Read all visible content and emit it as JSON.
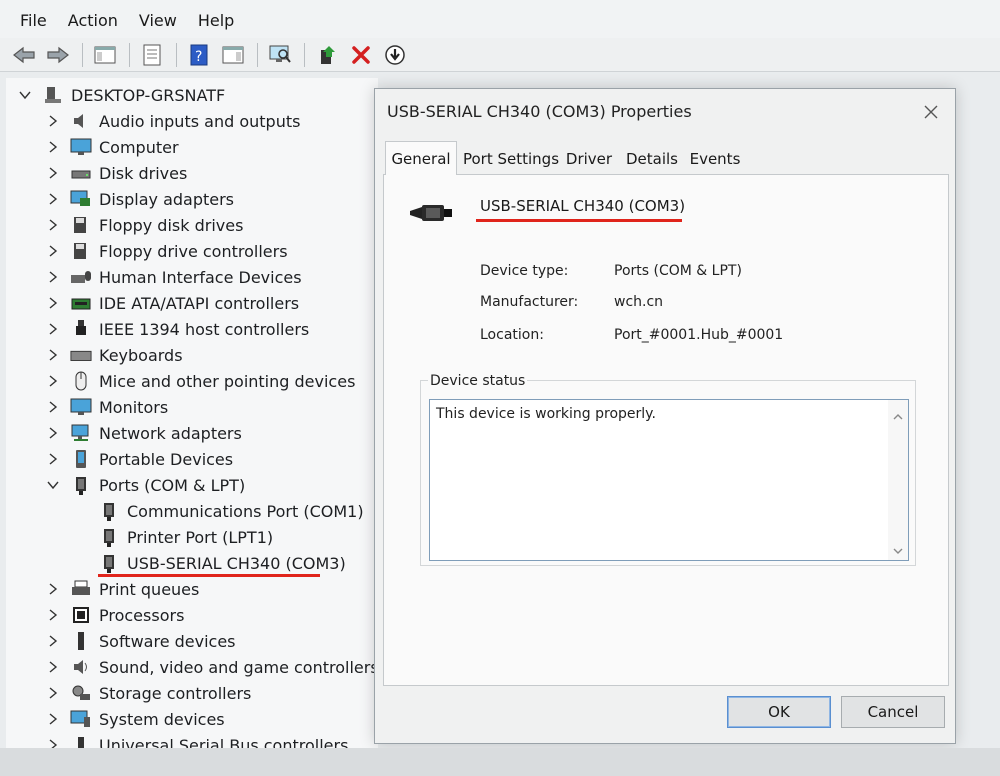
{
  "menu": [
    "File",
    "Action",
    "View",
    "Help"
  ],
  "toolbar": {
    "icons": [
      "back-arrow-icon",
      "forward-arrow-icon",
      "show-hide-tree-icon",
      "properties-icon",
      "help-icon",
      "action-pane-icon",
      "scan-hardware-icon",
      "update-driver-icon",
      "uninstall-icon",
      "disable-device-icon"
    ]
  },
  "tree": {
    "root": "DESKTOP-GRSNATF",
    "categories": [
      "Audio inputs and outputs",
      "Computer",
      "Disk drives",
      "Display adapters",
      "Floppy disk drives",
      "Floppy drive controllers",
      "Human Interface Devices",
      "IDE ATA/ATAPI controllers",
      "IEEE 1394 host controllers",
      "Keyboards",
      "Mice and other pointing devices",
      "Monitors",
      "Network adapters",
      "Portable Devices",
      "Ports (COM & LPT)"
    ],
    "ports_children": [
      "Communications Port (COM1)",
      "Printer Port (LPT1)",
      "USB-SERIAL CH340 (COM3)"
    ],
    "categories_after": [
      "Print queues",
      "Processors",
      "Software devices",
      "Sound, video and game controllers",
      "Storage controllers",
      "System devices",
      "Universal Serial Bus controllers"
    ]
  },
  "dialog": {
    "title": "USB-SERIAL CH340 (COM3) Properties",
    "tabs": [
      "General",
      "Port Settings",
      "Driver",
      "Details",
      "Events"
    ],
    "device_name": "USB-SERIAL CH340 (COM3)",
    "device_type_label": "Device type:",
    "device_type": "Ports (COM & LPT)",
    "manufacturer_label": "Manufacturer:",
    "manufacturer": "wch.cn",
    "location_label": "Location:",
    "location": "Port_#0001.Hub_#0001",
    "status_legend": "Device status",
    "status_text": "This device is working properly.",
    "ok_label": "OK",
    "cancel_label": "Cancel"
  },
  "colors": {
    "highlight_underline": "#e0241b",
    "ok_border": "#5a8fd0"
  }
}
